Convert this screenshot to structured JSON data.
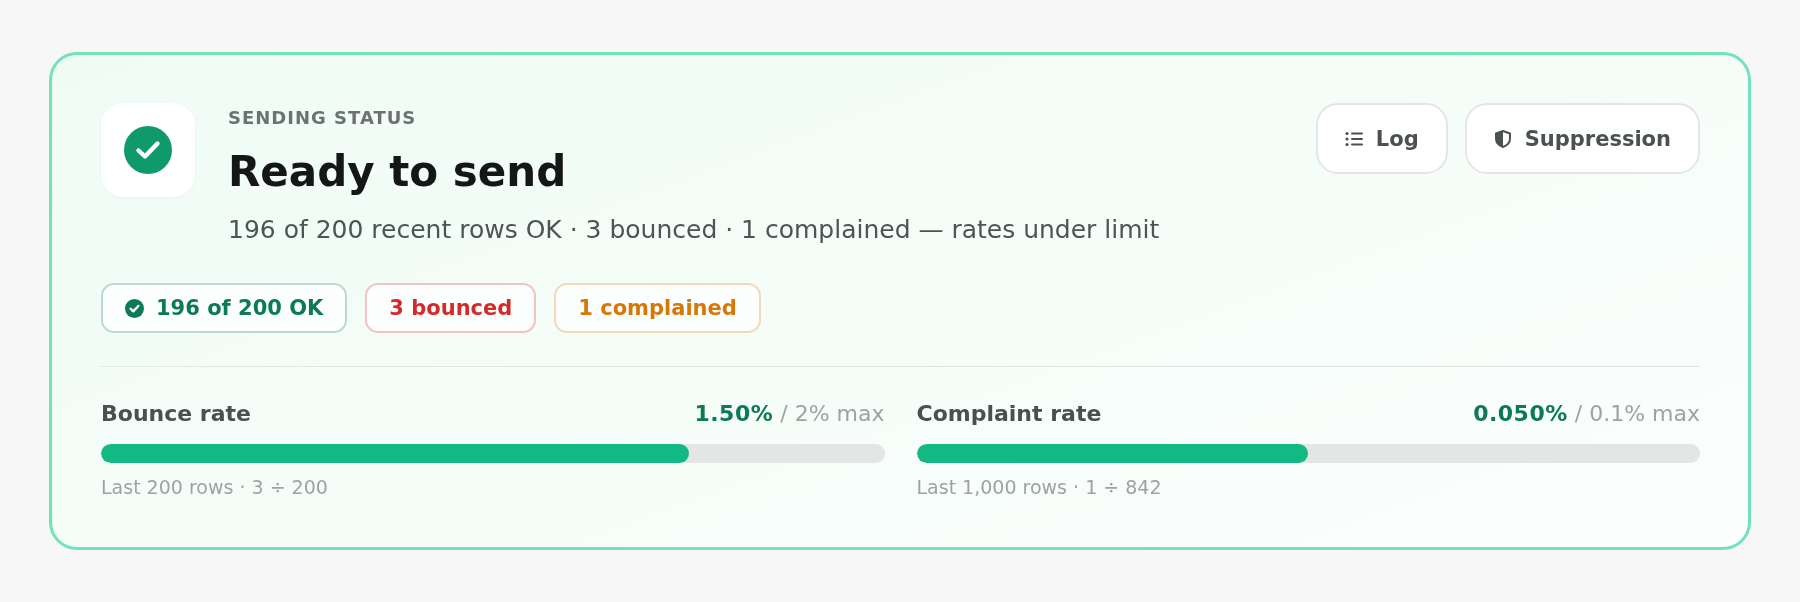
{
  "status": {
    "eyebrow": "SENDING STATUS",
    "title": "Ready to send",
    "summary": "196 of 200 recent rows OK · 3 bounced · 1 complained — rates under limit"
  },
  "actions": [
    {
      "label": "Log",
      "kind": "list"
    },
    {
      "label": "Suppression",
      "kind": "shield"
    }
  ],
  "pills": [
    {
      "label": "196 of 200 OK",
      "kind": "icon",
      "color": "#0b7a55"
    },
    {
      "label": "3 bounced",
      "kind": "text",
      "color": "#d42a2a"
    },
    {
      "label": "1 complained",
      "kind": "text",
      "color": "#d97706"
    }
  ],
  "meters": [
    {
      "label": "Bounce rate",
      "value": "1.50%",
      "limit": "/ 2% max",
      "level": 0.75,
      "note": "Last 200 rows · 3 ÷ 200"
    },
    {
      "label": "Complaint rate",
      "value": "0.050%",
      "limit": "/ 0.1% max",
      "level": 0.5,
      "note": "Last 1,000 rows · 1 ÷ 842"
    }
  ]
}
